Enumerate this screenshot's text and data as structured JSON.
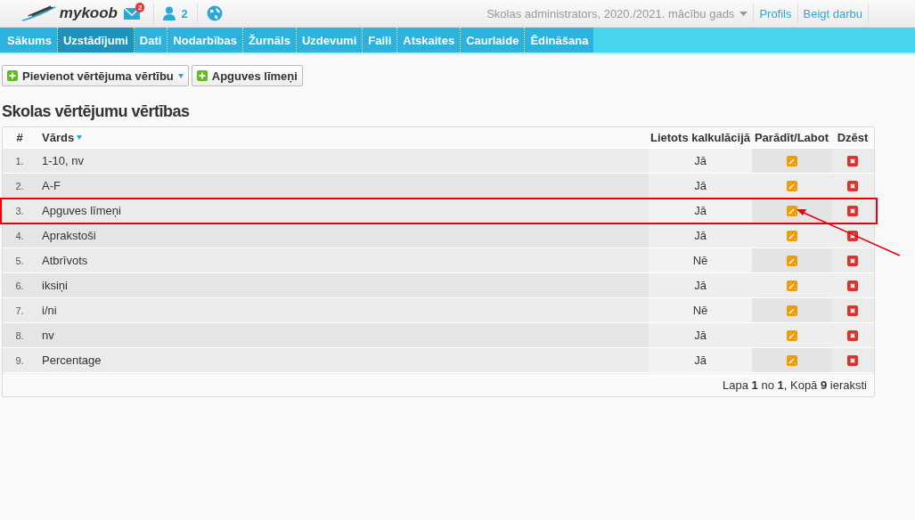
{
  "header": {
    "logo": "mykoob",
    "messages_badge": "2",
    "users_count": "2",
    "role": "Skolas administrators, 2020./2021. mācību gads",
    "links": [
      "Profils",
      "Beigt darbu"
    ]
  },
  "nav": [
    {
      "label": "Sākums",
      "selected": false
    },
    {
      "label": "Uzstādījumi",
      "selected": true
    },
    {
      "label": "Dati",
      "selected": false
    },
    {
      "label": "Nodarbības",
      "selected": false
    },
    {
      "label": "Žurnāls",
      "selected": false
    },
    {
      "label": "Uzdevumi",
      "selected": false
    },
    {
      "label": "Faili",
      "selected": false
    },
    {
      "label": "Atskaites",
      "selected": false
    },
    {
      "label": "Caurlaide",
      "selected": false
    },
    {
      "label": "Ēdināšana",
      "selected": false
    }
  ],
  "toolbar": [
    {
      "label": "Pievienot vērtējuma vērtību",
      "dropdown": true
    },
    {
      "label": "Apguves līmeņi",
      "dropdown": false
    }
  ],
  "title": "Skolas vērtējumu vērtības",
  "table": {
    "columns": [
      "#",
      "Vārds",
      "Lietots kalkulācijā",
      "Parādīt/Labot",
      "Dzēst"
    ],
    "rows": [
      {
        "num": "1.",
        "name": "1-10, nv",
        "used": "Jā",
        "highlighted": false
      },
      {
        "num": "2.",
        "name": "A-F",
        "used": "Jā",
        "highlighted": false
      },
      {
        "num": "3.",
        "name": "Apguves līmeņi",
        "used": "Jā",
        "highlighted": true
      },
      {
        "num": "4.",
        "name": "Aprakstoši",
        "used": "Jā",
        "highlighted": false
      },
      {
        "num": "5.",
        "name": "Atbrīvots",
        "used": "Nē",
        "highlighted": false
      },
      {
        "num": "6.",
        "name": "iksiņi",
        "used": "Jā",
        "highlighted": false
      },
      {
        "num": "7.",
        "name": "i/ni",
        "used": "Nē",
        "highlighted": false
      },
      {
        "num": "8.",
        "name": "nv",
        "used": "Jā",
        "highlighted": false
      },
      {
        "num": "9.",
        "name": "Percentage",
        "used": "Jā",
        "highlighted": false
      }
    ],
    "footer": "Lapa **1** no **1**, Kopā **9** ieraksti"
  }
}
